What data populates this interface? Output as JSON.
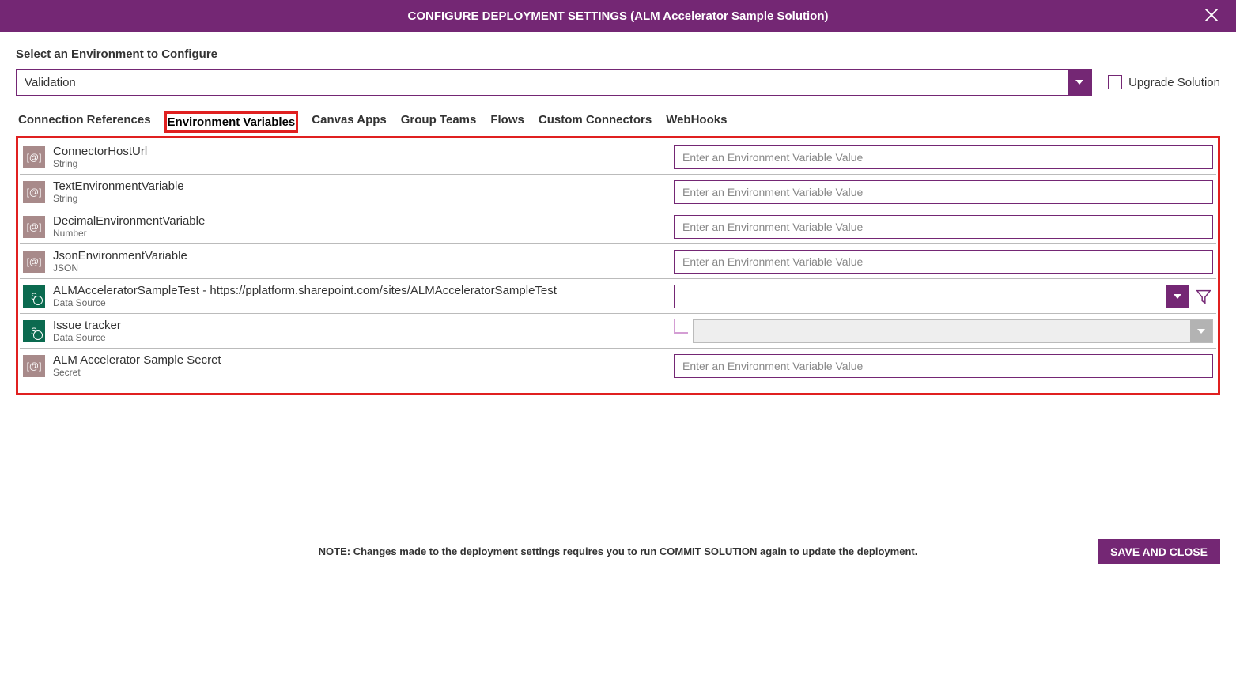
{
  "header": {
    "title": "CONFIGURE DEPLOYMENT SETTINGS (ALM Accelerator Sample Solution)"
  },
  "select_label": "Select an Environment to Configure",
  "environment": "Validation",
  "upgrade_label": "Upgrade Solution",
  "tabs": [
    "Connection References",
    "Environment Variables",
    "Canvas Apps",
    "Group Teams",
    "Flows",
    "Custom Connectors",
    "WebHooks"
  ],
  "active_tab_index": 1,
  "vars": [
    {
      "name": "ConnectorHostUrl",
      "type": "String",
      "kind": "text",
      "placeholder": "Enter an Environment Variable Value",
      "icon": "var"
    },
    {
      "name": "TextEnvironmentVariable",
      "type": "String",
      "kind": "text",
      "placeholder": "Enter an Environment Variable Value",
      "icon": "var"
    },
    {
      "name": "DecimalEnvironmentVariable",
      "type": "Number",
      "kind": "text",
      "placeholder": "Enter an Environment Variable Value",
      "icon": "var"
    },
    {
      "name": "JsonEnvironmentVariable",
      "type": "JSON",
      "kind": "text",
      "placeholder": "Enter an Environment Variable Value",
      "icon": "var"
    },
    {
      "name": "ALMAcceleratorSampleTest - https://pplatform.sharepoint.com/sites/ALMAcceleratorSampleTest",
      "type": "Data Source",
      "kind": "datasource",
      "icon": "sp"
    },
    {
      "name": "Issue tracker",
      "type": "Data Source",
      "kind": "datasource_child",
      "icon": "sp"
    },
    {
      "name": "ALM Accelerator Sample Secret",
      "type": "Secret",
      "kind": "text",
      "placeholder": "Enter an Environment Variable Value",
      "icon": "var"
    }
  ],
  "footer_note": "NOTE: Changes made to the deployment settings requires you to run COMMIT SOLUTION again to update the deployment.",
  "save_label": "SAVE AND CLOSE"
}
